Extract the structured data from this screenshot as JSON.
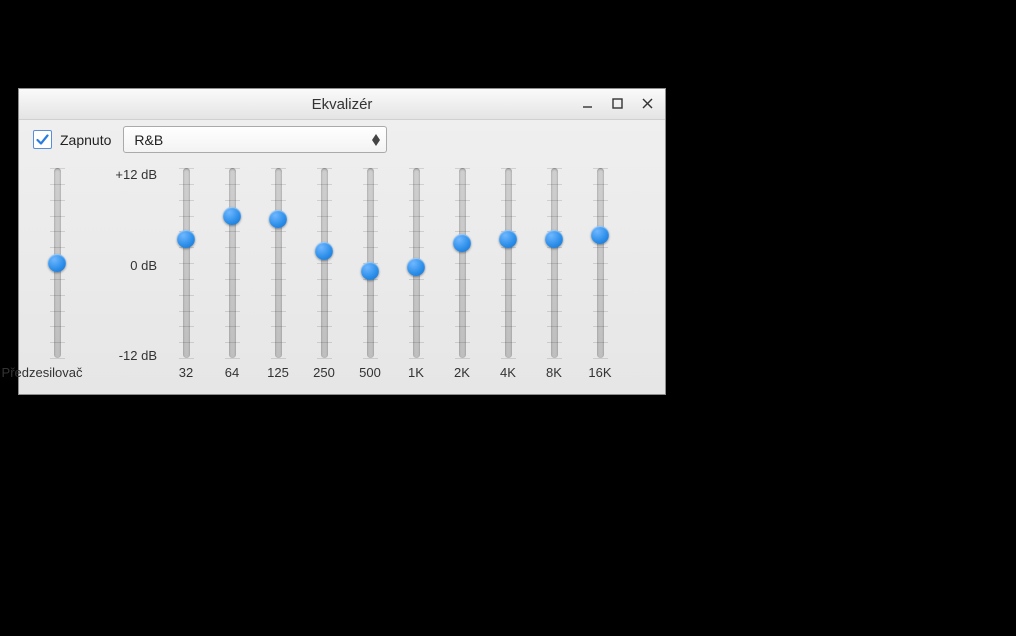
{
  "window": {
    "title": "Ekvalizér",
    "checkbox_checked": true,
    "checkbox_label": "Zapnuto",
    "preset_selected": "R&B"
  },
  "scale": {
    "top": "+12 dB",
    "mid": "0 dB",
    "bottom": "-12 dB"
  },
  "preamp": {
    "label": "Předzesilovač",
    "value_db": 0
  },
  "bands": [
    {
      "freq": "32",
      "value_db": 3
    },
    {
      "freq": "64",
      "value_db": 6
    },
    {
      "freq": "125",
      "value_db": 5.5
    },
    {
      "freq": "250",
      "value_db": 1.5
    },
    {
      "freq": "500",
      "value_db": -1
    },
    {
      "freq": "1K",
      "value_db": -0.5
    },
    {
      "freq": "2K",
      "value_db": 2.5
    },
    {
      "freq": "4K",
      "value_db": 3
    },
    {
      "freq": "8K",
      "value_db": 3
    },
    {
      "freq": "16K",
      "value_db": 3.5
    }
  ],
  "range_db": {
    "min": -12,
    "max": 12
  },
  "icons": {
    "minimize": "minimize-icon",
    "maximize": "maximize-icon",
    "close": "close-icon",
    "checkmark": "checkmark-icon",
    "dropdown_arrows": "up-down-arrows-icon"
  }
}
